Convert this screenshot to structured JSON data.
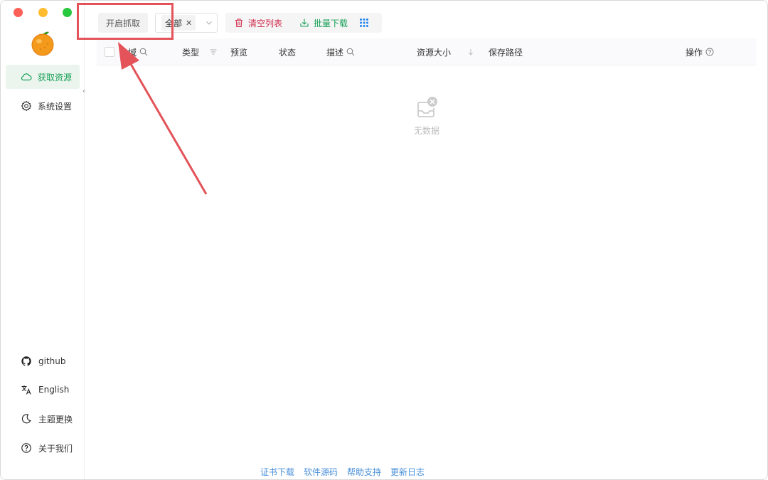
{
  "sidebar": {
    "logo_icon": "orange-logo",
    "items": [
      {
        "label": "获取资源",
        "icon": "cloud-icon",
        "active": true
      },
      {
        "label": "系统设置",
        "icon": "gear-icon",
        "active": false
      }
    ],
    "bottom_items": [
      {
        "label": "github",
        "icon": "github-icon"
      },
      {
        "label": "English",
        "icon": "translate-icon"
      },
      {
        "label": "主题更换",
        "icon": "moon-icon"
      },
      {
        "label": "关于我们",
        "icon": "help-circle-icon"
      }
    ]
  },
  "toolbar": {
    "capture_label": "开启抓取",
    "filter_tag": "全部",
    "clear_label": "清空列表",
    "batch_download_label": "批量下载",
    "grid_icon": "grid-icon"
  },
  "table": {
    "columns": [
      {
        "label": "域",
        "icon": "search-icon"
      },
      {
        "label": "类型",
        "icon": "filter-icon"
      },
      {
        "label": "预览"
      },
      {
        "label": "状态"
      },
      {
        "label": "描述",
        "icon": "search-icon"
      },
      {
        "label": "资源大小",
        "icon": "sort-icon"
      },
      {
        "label": "保存路径"
      },
      {
        "label": "操作",
        "icon": "help-circle-icon"
      }
    ],
    "empty_text": "无数据"
  },
  "footer": {
    "links": [
      "证书下载",
      "软件源码",
      "帮助支持",
      "更新日志"
    ]
  },
  "colors": {
    "accent_green": "#18a058",
    "danger_red": "#d03050",
    "link_blue": "#4a90d9",
    "annotation_red": "#e35359"
  }
}
